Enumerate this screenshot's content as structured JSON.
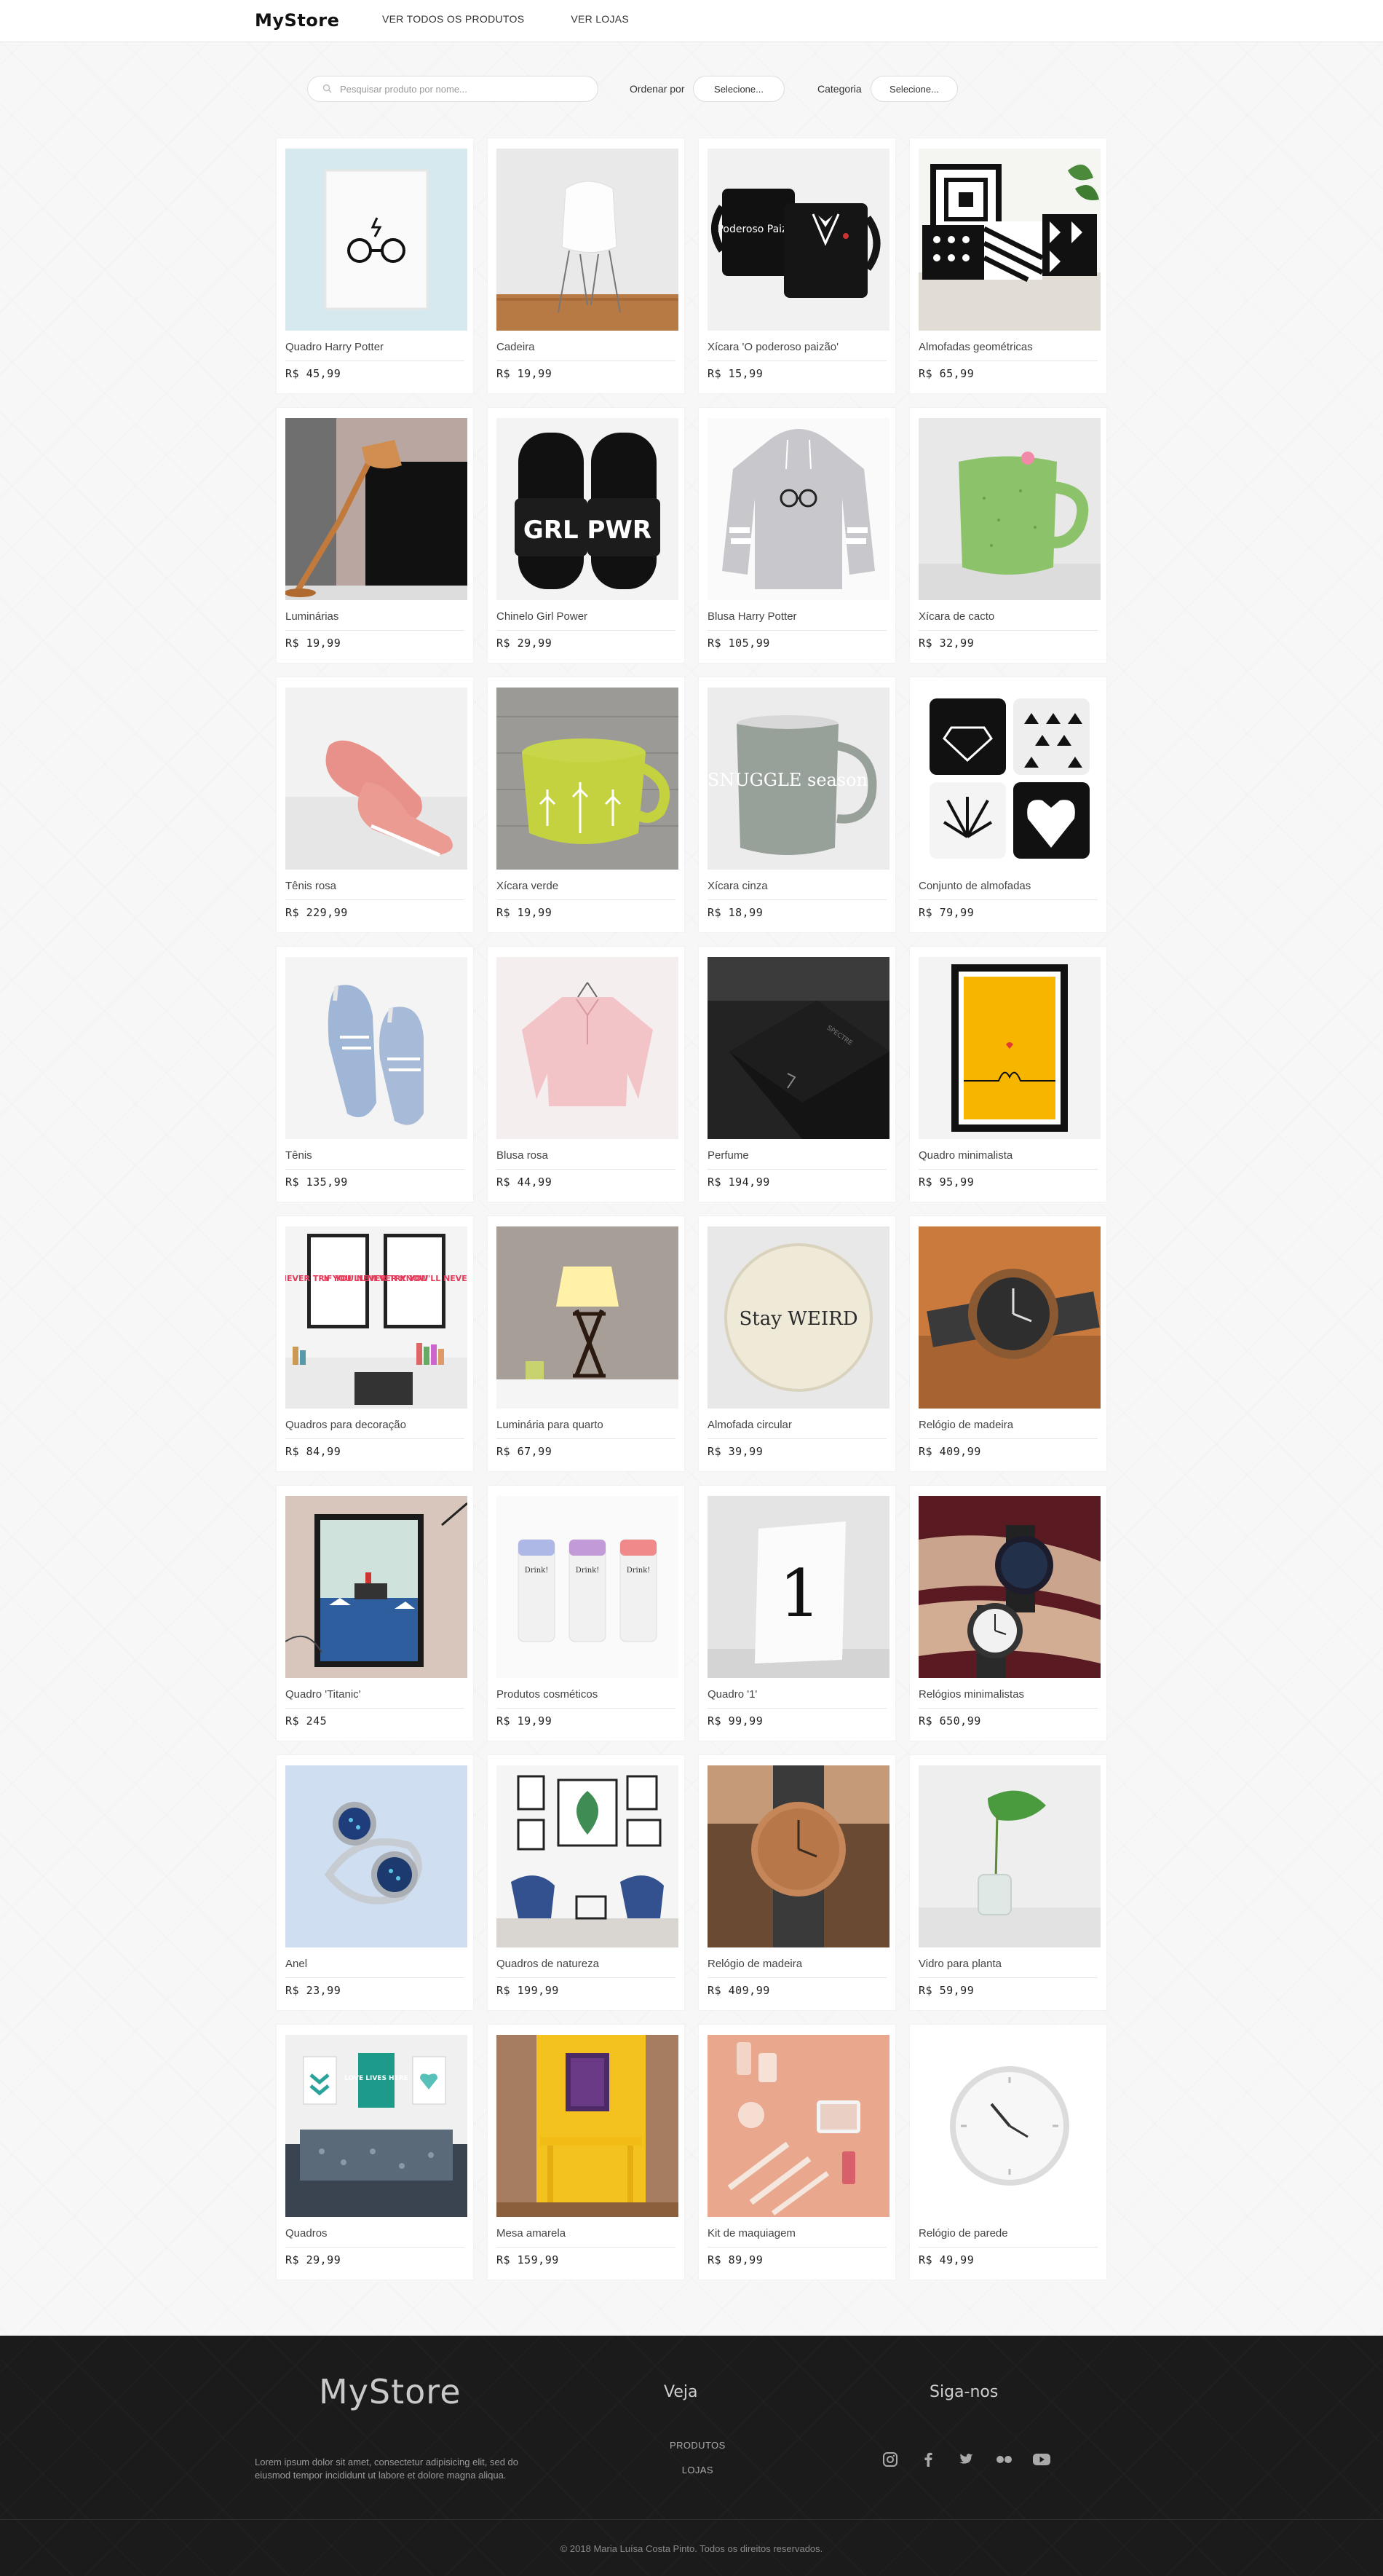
{
  "header": {
    "brand": "MyStore",
    "nav": [
      "VER TODOS OS PRODUTOS",
      "VER LOJAS"
    ]
  },
  "filters": {
    "search_placeholder": "Pesquisar produto por nome...",
    "order_label": "Ordenar por",
    "order_value": "Selecione...",
    "category_label": "Categoria",
    "category_value": "Selecione..."
  },
  "products": [
    {
      "name": "Quadro Harry Potter",
      "price": "R$ 45,99"
    },
    {
      "name": "Cadeira",
      "price": "R$ 19,99"
    },
    {
      "name": "Xícara 'O poderoso paizão'",
      "price": "R$ 15,99"
    },
    {
      "name": "Almofadas geométricas",
      "price": "R$ 65,99"
    },
    {
      "name": "Luminárias",
      "price": "R$ 19,99"
    },
    {
      "name": "Chinelo Girl Power",
      "price": "R$ 29,99"
    },
    {
      "name": "Blusa Harry Potter",
      "price": "R$ 105,99"
    },
    {
      "name": "Xícara de cacto",
      "price": "R$ 32,99"
    },
    {
      "name": "Tênis rosa",
      "price": "R$ 229,99"
    },
    {
      "name": "Xícara verde",
      "price": "R$ 19,99"
    },
    {
      "name": "Xícara cinza",
      "price": "R$ 18,99"
    },
    {
      "name": "Conjunto de almofadas",
      "price": "R$ 79,99"
    },
    {
      "name": "Tênis",
      "price": "R$ 135,99"
    },
    {
      "name": "Blusa rosa",
      "price": "R$ 44,99"
    },
    {
      "name": "Perfume",
      "price": "R$ 194,99"
    },
    {
      "name": "Quadro minimalista",
      "price": "R$ 95,99"
    },
    {
      "name": "Quadros para decoração",
      "price": "R$ 84,99"
    },
    {
      "name": "Luminária para quarto",
      "price": "R$ 67,99"
    },
    {
      "name": "Almofada circular",
      "price": "R$ 39,99"
    },
    {
      "name": "Relógio de madeira",
      "price": "R$ 409,99"
    },
    {
      "name": "Quadro 'Titanic'",
      "price": "R$ 245"
    },
    {
      "name": "Produtos cosméticos",
      "price": "R$ 19,99"
    },
    {
      "name": "Quadro '1'",
      "price": "R$ 99,99"
    },
    {
      "name": "Relógios minimalistas",
      "price": "R$ 650,99"
    },
    {
      "name": "Anel",
      "price": "R$ 23,99"
    },
    {
      "name": "Quadros de natureza",
      "price": "R$ 199,99"
    },
    {
      "name": "Relógio de madeira",
      "price": "R$ 409,99"
    },
    {
      "name": "Vidro para planta",
      "price": "R$ 59,99"
    },
    {
      "name": "Quadros",
      "price": "R$ 29,99"
    },
    {
      "name": "Mesa amarela",
      "price": "R$ 159,99"
    },
    {
      "name": "Kit de maquiagem",
      "price": "R$ 89,99"
    },
    {
      "name": "Relógio de parede",
      "price": "R$ 49,99"
    }
  ],
  "image_text": {
    "mug_poderoso": "Poderoso Paizão",
    "slippers": "GRL PWR",
    "mug_snuggle": "SNUGGLE season",
    "poster_if": "IF YOU NEVER TRY YOU'LL NEVER KNOW",
    "pillow_weird": "Stay WEIRD",
    "drink": "Drink!",
    "frame_one": "1",
    "love_lives_here": "LOVE LIVES HERE",
    "perfume_box": "SPECTRE"
  },
  "footer": {
    "brand": "MyStore",
    "text": "Lorem ipsum dolor sit amet, consectetur adipisicing elit, sed do eiusmod tempor incididunt ut labore et dolore magna aliqua.",
    "veja_title": "Veja",
    "links": [
      "PRODUTOS",
      "LOJAS"
    ],
    "siga_title": "Siga-nos",
    "social_icons": [
      "instagram-icon",
      "facebook-icon",
      "twitter-icon",
      "flickr-icon",
      "youtube-icon"
    ],
    "copyright": "© 2018 Maria Luísa Costa Pinto. Todos os direitos reservados."
  }
}
